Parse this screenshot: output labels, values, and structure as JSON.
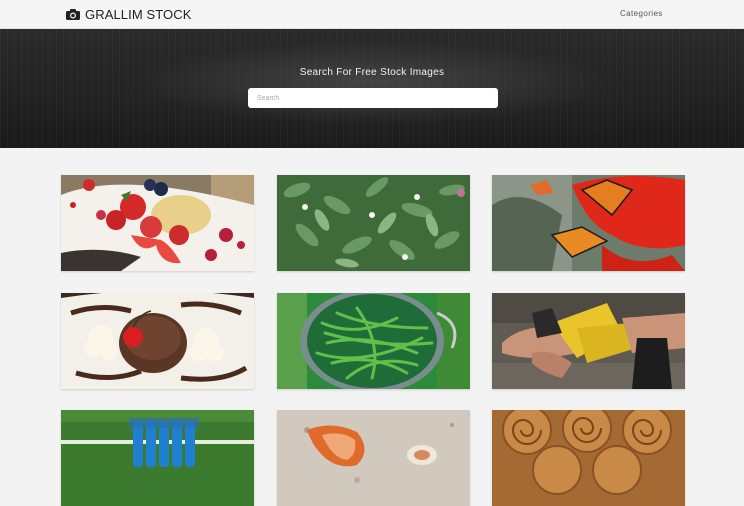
{
  "header": {
    "brand_name": "GRALLIM STOCK",
    "brand_icon": "camera-icon",
    "nav_link_label": "Categories"
  },
  "hero": {
    "title": "Search For Free Stock Images",
    "search_placeholder": "Search"
  },
  "gallery": {
    "images": [
      {
        "subject": "strawberries-and-berries-dessert",
        "icon": "photo-thumbnail"
      },
      {
        "subject": "green-leafy-plants-with-flowers",
        "icon": "photo-thumbnail"
      },
      {
        "subject": "monarch-butterflies-on-red-flower",
        "icon": "photo-thumbnail"
      },
      {
        "subject": "chocolate-cake-with-whipped-cream",
        "icon": "photo-thumbnail"
      },
      {
        "subject": "green-beans-in-colander",
        "icon": "photo-thumbnail"
      },
      {
        "subject": "boxer-wrapping-hand-wraps",
        "icon": "photo-thumbnail"
      },
      {
        "subject": "blue-water-bottles-on-field",
        "icon": "photo-thumbnail"
      },
      {
        "subject": "seashells-on-sand",
        "icon": "photo-thumbnail"
      },
      {
        "subject": "cinnamon-rolls",
        "icon": "photo-thumbnail"
      }
    ]
  },
  "colors": {
    "hero_background": "#1e1e1e",
    "page_background": "#f3f3f3",
    "navbar_background": "#f5f5f5"
  }
}
